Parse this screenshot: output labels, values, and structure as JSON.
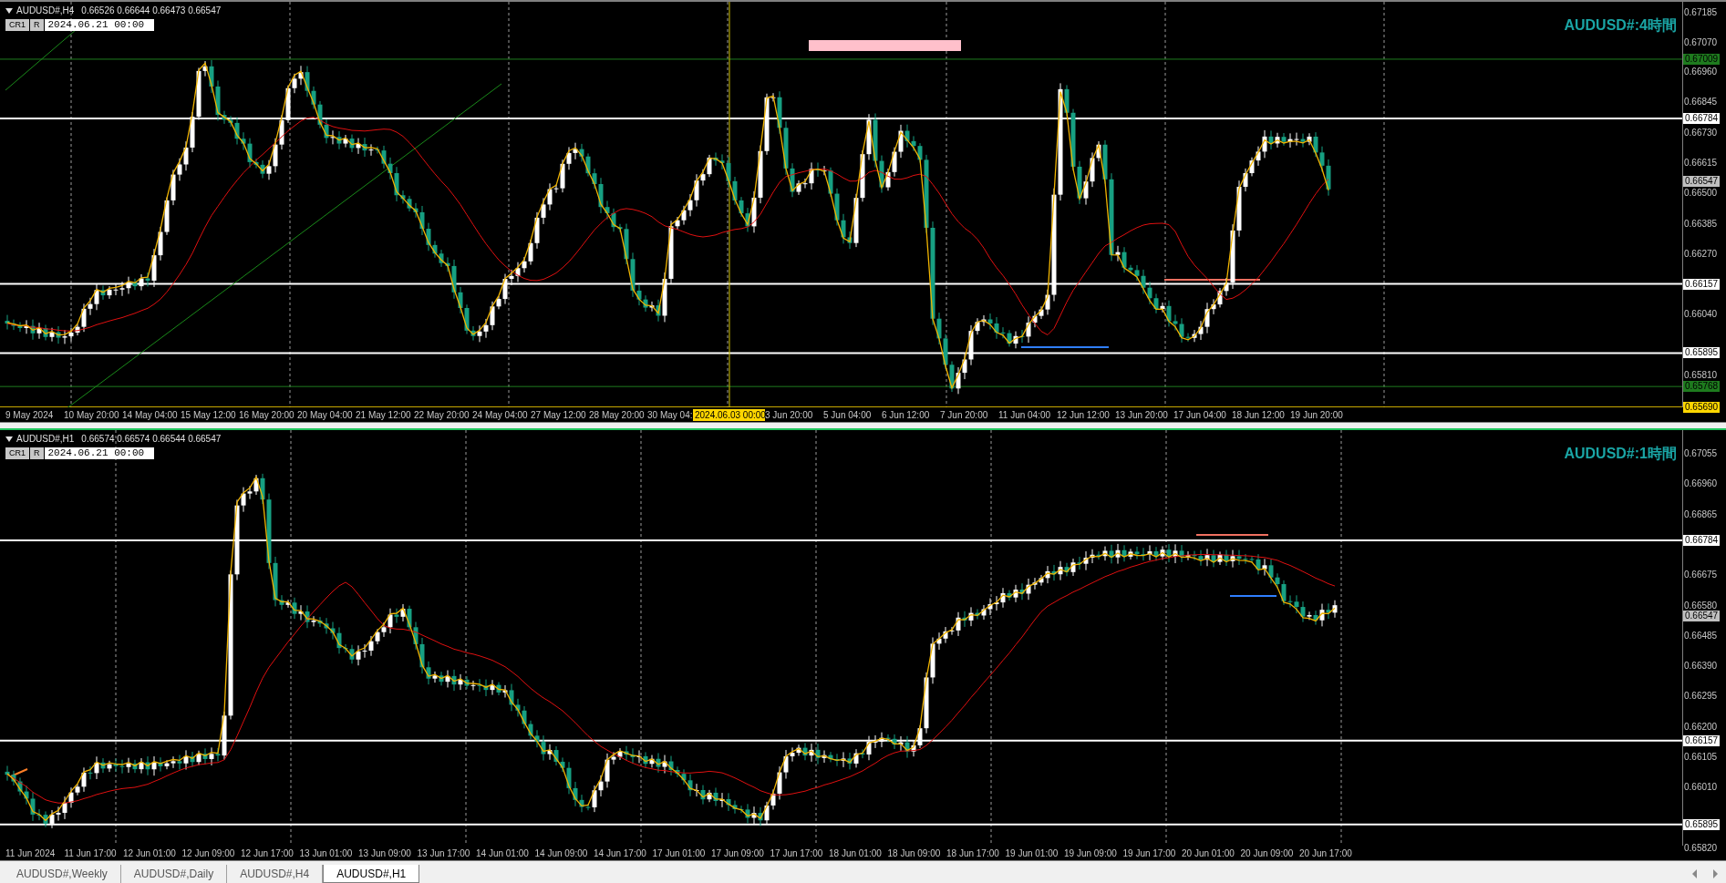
{
  "charts": [
    {
      "symbol": "AUDUSD#,H4",
      "ohlc": "0.66526 0.66644 0.66473 0.66547",
      "active": false,
      "buttons": [
        "CR1",
        "R"
      ],
      "date_field": "2024.06.21 00:00",
      "watermark": "AUDUSD#:4時間",
      "price_ticks": [
        "0.67185",
        "0.67070",
        "0.66960",
        "0.66845",
        "0.66730",
        "0.66615",
        "0.66500",
        "0.66385",
        "0.66270",
        "0.66040",
        "0.65810"
      ],
      "price_labels": [
        {
          "text": "0.67009",
          "color": "#1e7b1e",
          "kind": "line"
        },
        {
          "text": "0.66784",
          "color": "#ffffff",
          "kind": "line"
        },
        {
          "text": "0.66547",
          "color": "#c0c0c0",
          "kind": "bid"
        },
        {
          "text": "0.66157",
          "color": "#ffffff",
          "kind": "line"
        },
        {
          "text": "0.65895",
          "color": "#ffffff",
          "kind": "line"
        },
        {
          "text": "0.65768",
          "color": "#1e7b1e",
          "kind": "line"
        },
        {
          "text": "0.65690",
          "color": "#ffd700",
          "kind": "line"
        }
      ],
      "time_labels": [
        "9 May 2024",
        "10 May 20:00",
        "14 May 04:00",
        "15 May 12:00",
        "16 May 20:00",
        "20 May 04:00",
        "21 May 12:00",
        "22 May 20:00",
        "24 May 04:00",
        "27 May 12:00",
        "28 May 20:00",
        "30 May 04:",
        "3 Jun 20:00",
        "5 Jun 04:00",
        "6 Jun 12:00",
        "7 Jun 20:00",
        "11 Jun 04:00",
        "12 Jun 12:00",
        "13 Jun 20:00",
        "17 Jun 04:00",
        "18 Jun 12:00",
        "19 Jun 20:00"
      ],
      "time_highlight": "2024.06.03 00:00"
    },
    {
      "symbol": "AUDUSD#,H1",
      "ohlc": "0.66574 0.66574 0.66544 0.66547",
      "active": true,
      "buttons": [
        "CR1",
        "R"
      ],
      "date_field": "2024.06.21 00:00",
      "watermark": "AUDUSD#:1時間",
      "price_ticks": [
        "0.67055",
        "0.66960",
        "0.66865",
        "0.66675",
        "0.66580",
        "0.66485",
        "0.66390",
        "0.66295",
        "0.66200",
        "0.66105",
        "0.66010",
        "0.65820"
      ],
      "price_labels": [
        {
          "text": "0.66784",
          "color": "#ffffff",
          "kind": "line"
        },
        {
          "text": "0.66547",
          "color": "#c0c0c0",
          "kind": "bid"
        },
        {
          "text": "0.66157",
          "color": "#ffffff",
          "kind": "line"
        },
        {
          "text": "0.65895",
          "color": "#ffffff",
          "kind": "line"
        }
      ],
      "time_labels": [
        "11 Jun 2024",
        "11 Jun 17:00",
        "12 Jun 01:00",
        "12 Jun 09:00",
        "12 Jun 17:00",
        "13 Jun 01:00",
        "13 Jun 09:00",
        "13 Jun 17:00",
        "14 Jun 01:00",
        "14 Jun 09:00",
        "14 Jun 17:00",
        "17 Jun 01:00",
        "17 Jun 09:00",
        "17 Jun 17:00",
        "18 Jun 01:00",
        "18 Jun 09:00",
        "18 Jun 17:00",
        "19 Jun 01:00",
        "19 Jun 09:00",
        "19 Jun 17:00",
        "20 Jun 01:00",
        "20 Jun 09:00",
        "20 Jun 17:00"
      ]
    }
  ],
  "tabs": [
    {
      "label": "AUDUSD#,Weekly",
      "selected": false
    },
    {
      "label": "AUDUSD#,Daily",
      "selected": false
    },
    {
      "label": "AUDUSD#,H4",
      "selected": false
    },
    {
      "label": "AUDUSD#,H1",
      "selected": true
    }
  ]
}
